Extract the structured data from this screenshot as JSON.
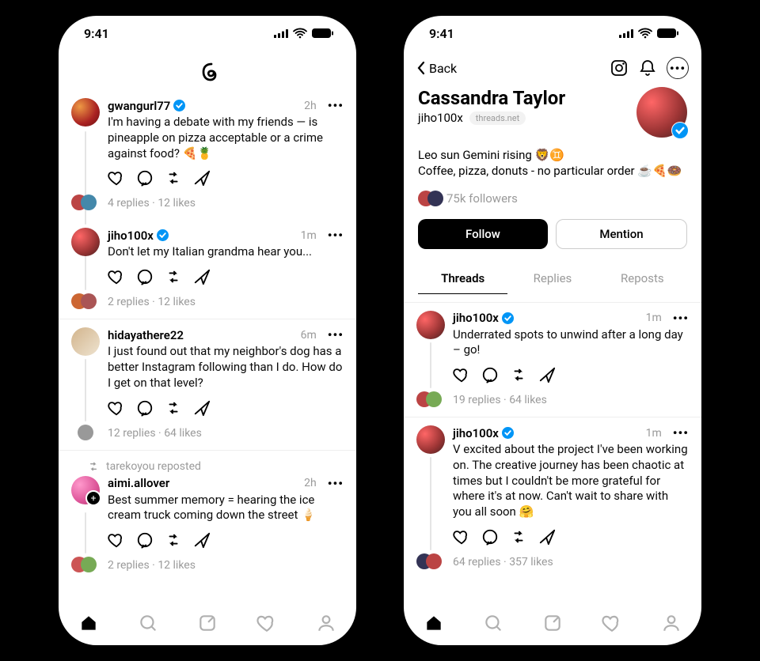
{
  "status": {
    "time": "9:41"
  },
  "left": {
    "posts": [
      {
        "user": "gwangurl77",
        "verified": true,
        "time": "2h",
        "text": "I'm having a debate with my friends — is pineapple on pizza acceptable or a crime against food? 🍕🍍",
        "replies": "4 replies",
        "likes": "12 likes",
        "avclass": "av-red"
      },
      {
        "user": "jiho100x",
        "verified": true,
        "time": "1m",
        "text": "Don't let my Italian grandma hear you...",
        "replies": "2 replies",
        "likes": "12 likes",
        "avclass": "av-rose"
      },
      {
        "user": "hidayathere22",
        "verified": false,
        "time": "6m",
        "text": "I just found out that my neighbor's dog has a better Instagram following than I do. How do I get on that level?",
        "replies": "12 replies",
        "likes": "64 likes",
        "avclass": "av-tan"
      },
      {
        "repost_note": "tarekoyou reposted",
        "user": "aimi.allover",
        "verified": false,
        "time": "2h",
        "text": "Best summer memory = hearing the ice cream truck coming down the street 🍦",
        "replies": "2 replies",
        "likes": "12 likes",
        "avclass": "av-pink",
        "follow_badge": true
      }
    ]
  },
  "right": {
    "back": "Back",
    "profile": {
      "name": "Cassandra Taylor",
      "handle": "jiho100x",
      "domain": "threads.net",
      "bio_line1": "Leo sun Gemini rising 🦁♊",
      "bio_line2": "Coffee, pizza, donuts - no particular order ☕🍕🍩",
      "followers": "75k followers",
      "follow_btn": "Follow",
      "mention_btn": "Mention"
    },
    "tabs": {
      "threads": "Threads",
      "replies": "Replies",
      "reposts": "Reposts"
    },
    "posts": [
      {
        "user": "jiho100x",
        "verified": true,
        "time": "1m",
        "text": "Underrated spots to unwind after a long day – go!",
        "replies": "19 replies",
        "likes": "64 likes"
      },
      {
        "user": "jiho100x",
        "verified": true,
        "time": "1m",
        "text": "V excited about the project I've been working on. The creative journey has been chaotic at times but I couldn't be more grateful for where it's at now. Can't wait to share with you all soon 🤗",
        "replies": "64 replies",
        "likes": "357 likes"
      }
    ]
  }
}
